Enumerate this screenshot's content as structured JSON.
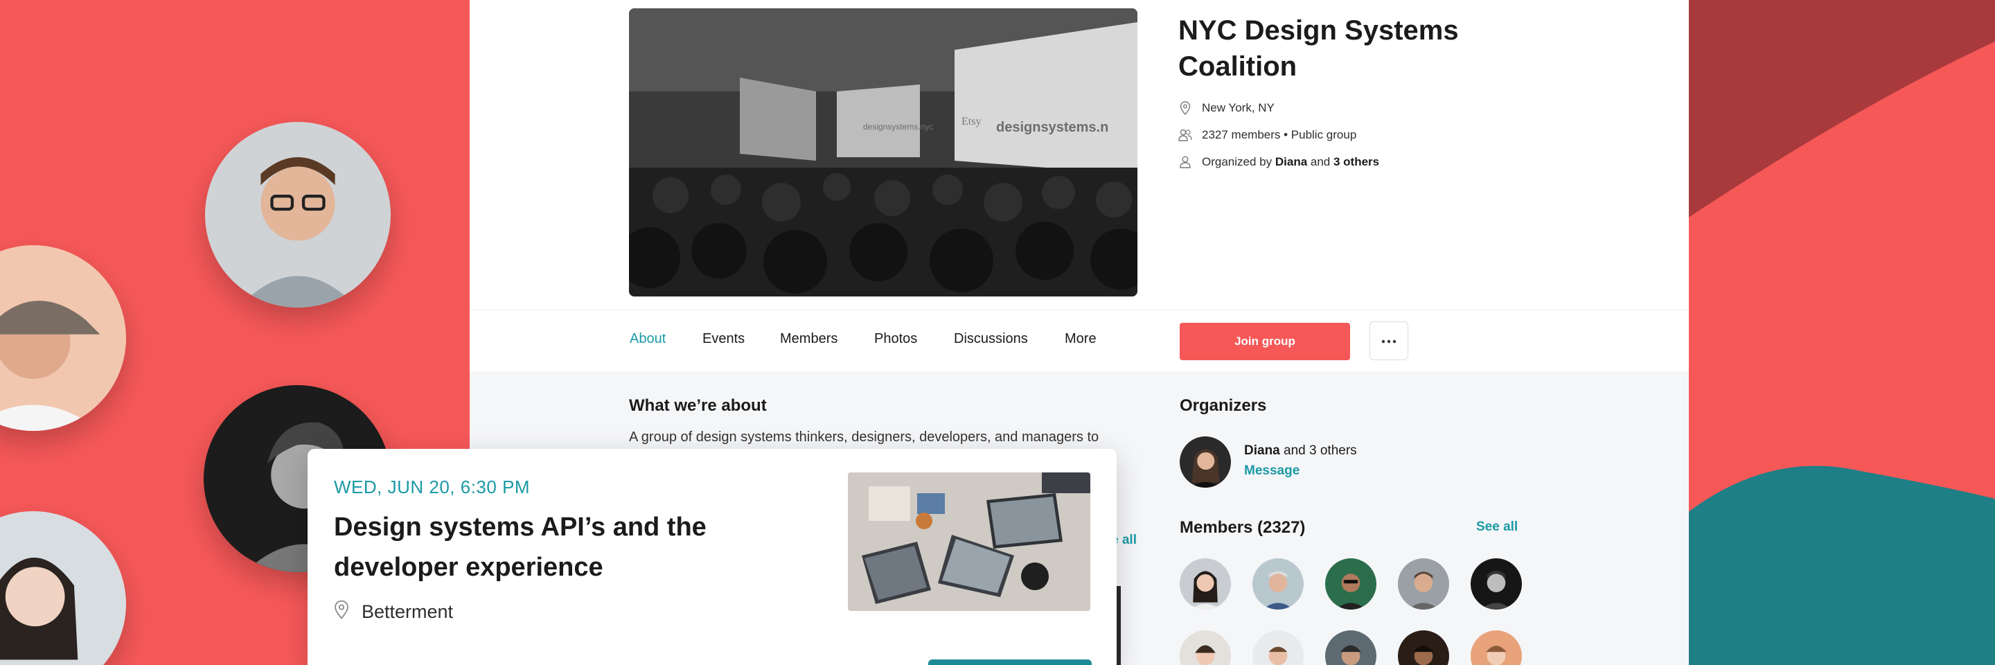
{
  "group": {
    "title": "NYC Design Systems Coalition",
    "location": "New York, NY",
    "members_line": "2327 members • Public group",
    "organized_prefix": "Organized by",
    "organizer_name": "Diana",
    "organized_and": "and",
    "organizer_others": "3 others",
    "hero_sign_1": "designsystems.nyc",
    "hero_sign_2": "Etsy",
    "hero_sign_3": "designsystems.n"
  },
  "nav": {
    "tabs": [
      "About",
      "Events",
      "Members",
      "Photos",
      "Discussions",
      "More"
    ],
    "active": "About",
    "join_label": "Join group",
    "more_label": "···"
  },
  "about": {
    "heading": "What we’re about",
    "text": "A group of design systems thinkers, designers, developers, and managers to",
    "see_all_partial": "e all"
  },
  "organizers": {
    "heading": "Organizers",
    "name": "Diana",
    "and": "and",
    "others": "3 others",
    "message": "Message"
  },
  "members": {
    "heading": "Members (2327)",
    "see_all": "See all"
  },
  "event": {
    "date": "WED, JUN 20, 6:30 PM",
    "title": "Design systems API’s and the developer experience",
    "venue": "Betterment"
  },
  "colors": {
    "brand_red": "#f65858",
    "link_teal": "#1b9aa6",
    "dark_teal": "#1f7f86"
  },
  "icons": [
    "location-pin-icon",
    "members-icon",
    "organizer-icon",
    "more-dots-icon",
    "location-pin-icon"
  ]
}
